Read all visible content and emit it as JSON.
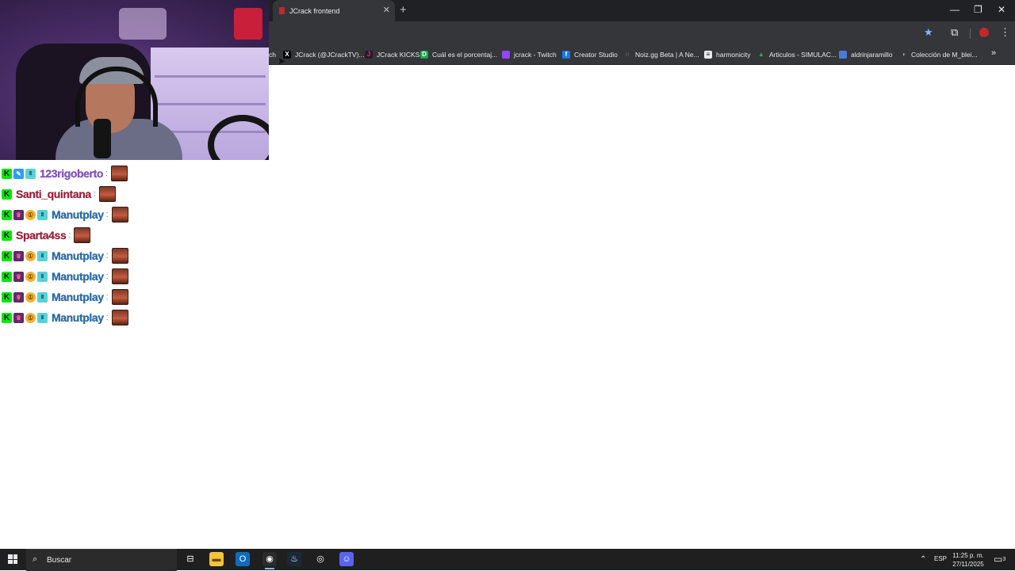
{
  "browser": {
    "tab_title": "JCrack frontend",
    "close_tab_glyph": "✕",
    "new_tab_glyph": "+",
    "window_controls": [
      "—",
      "❐",
      "✕"
    ],
    "toolbar_icons": [
      "star-icon",
      "extensions-icon",
      "profile-icon",
      "menu-icon"
    ],
    "bookmarks": [
      {
        "label": "ch",
        "icon": ""
      },
      {
        "label": "JCrack (@JCrackTV)...",
        "icon": "x-icon"
      },
      {
        "label": "JCrack KICKS",
        "icon": "jcrack-icon"
      },
      {
        "label": "Cuál es el porcentaj...",
        "icon": "green-doc-icon"
      },
      {
        "label": "jcrack - Twitch",
        "icon": "twitch-icon"
      },
      {
        "label": "Creator Studio",
        "icon": "facebook-icon"
      },
      {
        "label": "Noiz.gg Beta | A Ne...",
        "icon": "noiz-icon"
      },
      {
        "label": "harmonicity",
        "icon": "harmonicity-icon"
      },
      {
        "label": "Articulos - SIMULAC...",
        "icon": "drive-icon"
      },
      {
        "label": "aldrinjaramillo",
        "icon": "calendar-icon"
      },
      {
        "label": "Colección de M_blei...",
        "icon": "globe-icon"
      }
    ],
    "more_bookmarks_glyph": "»"
  },
  "chat": {
    "messages": [
      {
        "username": "123rigoberto",
        "color": "#8a4fd8",
        "badges": [
          "kick",
          "mod",
          "rank"
        ]
      },
      {
        "username": "Santi_quintana",
        "color": "#b0183c",
        "badges": [
          "kick"
        ]
      },
      {
        "username": "Manutplay",
        "color": "#1e6fc0",
        "badges": [
          "kick",
          "sub",
          "coin",
          "rank"
        ]
      },
      {
        "username": "Sparta4ss",
        "color": "#b0183c",
        "badges": [
          "kick"
        ]
      },
      {
        "username": "Manutplay",
        "color": "#1e6fc0",
        "badges": [
          "kick",
          "sub",
          "coin",
          "rank"
        ]
      },
      {
        "username": "Manutplay",
        "color": "#1e6fc0",
        "badges": [
          "kick",
          "sub",
          "coin",
          "rank"
        ]
      },
      {
        "username": "Manutplay",
        "color": "#1e6fc0",
        "badges": [
          "kick",
          "sub",
          "coin",
          "rank"
        ]
      },
      {
        "username": "Manutplay",
        "color": "#1e6fc0",
        "badges": [
          "kick",
          "sub",
          "coin",
          "rank"
        ]
      }
    ]
  },
  "taskbar": {
    "search_placeholder": "Buscar",
    "language": "ESP",
    "time": "11:25 p. m.",
    "date": "27/11/2025",
    "notification_count": "3"
  }
}
